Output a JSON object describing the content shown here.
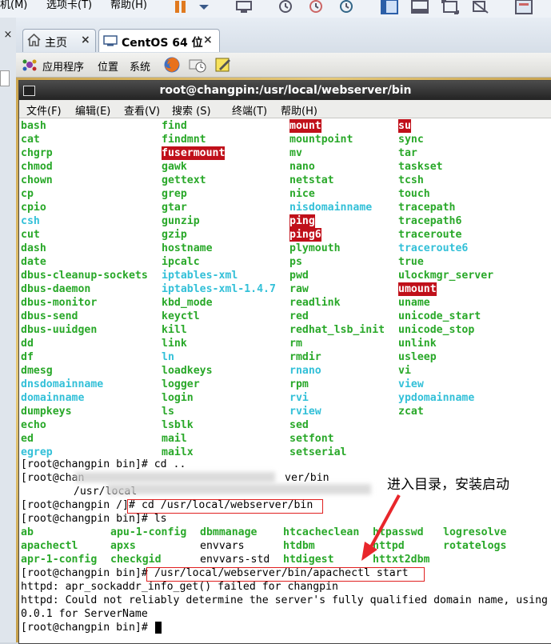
{
  "host": {
    "menu": [
      "机(M)",
      "选项卡(T)",
      "帮助(H)"
    ],
    "tabs": [
      {
        "label": "主页",
        "icon": "home-icon"
      },
      {
        "label": "CentOS 64 位",
        "icon": "vm-icon"
      }
    ],
    "close_glyph": "×"
  },
  "guest_panel": {
    "items": [
      "应用程序",
      "位置",
      "系统"
    ]
  },
  "terminal": {
    "title": "root@changpin:/usr/local/webserver/bin",
    "menu": [
      "文件(F)",
      "编辑(E)",
      "查看(V)",
      "搜索 (S)",
      "终端(T)",
      "帮助(H)"
    ],
    "bin_listing": [
      [
        [
          "bash",
          "g"
        ],
        [
          "find",
          "g"
        ],
        [
          "mount",
          "r"
        ],
        [
          "su",
          "r"
        ]
      ],
      [
        [
          "cat",
          "g"
        ],
        [
          "findmnt",
          "g"
        ],
        [
          "mountpoint",
          "g"
        ],
        [
          "sync",
          "g"
        ]
      ],
      [
        [
          "chgrp",
          "g"
        ],
        [
          "fusermount",
          "r"
        ],
        [
          "mv",
          "g"
        ],
        [
          "tar",
          "g"
        ]
      ],
      [
        [
          "chmod",
          "g"
        ],
        [
          "gawk",
          "g"
        ],
        [
          "nano",
          "g"
        ],
        [
          "taskset",
          "g"
        ]
      ],
      [
        [
          "chown",
          "g"
        ],
        [
          "gettext",
          "g"
        ],
        [
          "netstat",
          "g"
        ],
        [
          "tcsh",
          "g"
        ]
      ],
      [
        [
          "cp",
          "g"
        ],
        [
          "grep",
          "g"
        ],
        [
          "nice",
          "g"
        ],
        [
          "touch",
          "g"
        ]
      ],
      [
        [
          "cpio",
          "g"
        ],
        [
          "gtar",
          "g"
        ],
        [
          "nisdomainname",
          "b"
        ],
        [
          "tracepath",
          "g"
        ]
      ],
      [
        [
          "csh",
          "b"
        ],
        [
          "gunzip",
          "g"
        ],
        [
          "ping",
          "r"
        ],
        [
          "tracepath6",
          "g"
        ]
      ],
      [
        [
          "cut",
          "g"
        ],
        [
          "gzip",
          "g"
        ],
        [
          "ping6",
          "r"
        ],
        [
          "traceroute",
          "g"
        ]
      ],
      [
        [
          "dash",
          "g"
        ],
        [
          "hostname",
          "g"
        ],
        [
          "plymouth",
          "g"
        ],
        [
          "traceroute6",
          "b"
        ]
      ],
      [
        [
          "date",
          "g"
        ],
        [
          "ipcalc",
          "g"
        ],
        [
          "ps",
          "g"
        ],
        [
          "true",
          "g"
        ]
      ],
      [
        [
          "dbus-cleanup-sockets",
          "g"
        ],
        [
          "iptables-xml",
          "b"
        ],
        [
          "pwd",
          "g"
        ],
        [
          "ulockmgr_server",
          "g"
        ]
      ],
      [
        [
          "dbus-daemon",
          "g"
        ],
        [
          "iptables-xml-1.4.7",
          "b"
        ],
        [
          "raw",
          "g"
        ],
        [
          "umount",
          "r"
        ]
      ],
      [
        [
          "dbus-monitor",
          "g"
        ],
        [
          "kbd_mode",
          "g"
        ],
        [
          "readlink",
          "g"
        ],
        [
          "uname",
          "g"
        ]
      ],
      [
        [
          "dbus-send",
          "g"
        ],
        [
          "keyctl",
          "g"
        ],
        [
          "red",
          "g"
        ],
        [
          "unicode_start",
          "g"
        ]
      ],
      [
        [
          "dbus-uuidgen",
          "g"
        ],
        [
          "kill",
          "g"
        ],
        [
          "redhat_lsb_init",
          "g"
        ],
        [
          "unicode_stop",
          "g"
        ]
      ],
      [
        [
          "dd",
          "g"
        ],
        [
          "link",
          "g"
        ],
        [
          "rm",
          "g"
        ],
        [
          "unlink",
          "g"
        ]
      ],
      [
        [
          "df",
          "g"
        ],
        [
          "ln",
          "b"
        ],
        [
          "rmdir",
          "g"
        ],
        [
          "usleep",
          "g"
        ]
      ],
      [
        [
          "dmesg",
          "g"
        ],
        [
          "loadkeys",
          "g"
        ],
        [
          "rnano",
          "b"
        ],
        [
          "vi",
          "g"
        ]
      ],
      [
        [
          "dnsdomainname",
          "b"
        ],
        [
          "logger",
          "g"
        ],
        [
          "rpm",
          "g"
        ],
        [
          "view",
          "b"
        ]
      ],
      [
        [
          "domainname",
          "b"
        ],
        [
          "login",
          "g"
        ],
        [
          "rvi",
          "b"
        ],
        [
          "ypdomainname",
          "b"
        ]
      ],
      [
        [
          "dumpkeys",
          "g"
        ],
        [
          "ls",
          "g"
        ],
        [
          "rview",
          "b"
        ],
        [
          "zcat",
          "g"
        ]
      ],
      [
        [
          "echo",
          "g"
        ],
        [
          "lsblk",
          "g"
        ],
        [
          "sed",
          "g"
        ],
        [
          "",
          ""
        ]
      ],
      [
        [
          "ed",
          "g"
        ],
        [
          "mail",
          "g"
        ],
        [
          "setfont",
          "g"
        ],
        [
          "",
          ""
        ]
      ],
      [
        [
          "egrep",
          "b"
        ],
        [
          "mailx",
          "g"
        ],
        [
          "setserial",
          "g"
        ],
        [
          "",
          ""
        ]
      ]
    ],
    "line_cd_parent": "[root@changpin bin]# cd ..",
    "line_obscured_1": "[root@chan",
    "line_obscured_1_tail": "ver/bin",
    "line_obscured_2": "  /usr/local",
    "line_cd_prompt": "[root@changpin /]#",
    "line_cd_cmd": " cd /usr/local/webserver/bin",
    "line_ls": "[root@changpin bin]# ls",
    "dir_listing": [
      [
        [
          "ab",
          "g"
        ],
        [
          "apu-1-config",
          "g"
        ],
        [
          "dbmmanage",
          "g"
        ],
        [
          "htcacheclean",
          "g"
        ],
        [
          "htpasswd",
          "g"
        ],
        [
          "logresolve",
          "g"
        ]
      ],
      [
        [
          "apachectl",
          "g"
        ],
        [
          "apxs",
          "g"
        ],
        [
          "envvars",
          "plain"
        ],
        [
          "htdbm",
          "g"
        ],
        [
          "httpd",
          "g"
        ],
        [
          "rotatelogs",
          "g"
        ]
      ],
      [
        [
          "apr-1-config",
          "g"
        ],
        [
          "checkgid",
          "g"
        ],
        [
          "envvars-std",
          "plain"
        ],
        [
          "htdigest",
          "g"
        ],
        [
          "httxt2dbm",
          "g"
        ],
        [
          "",
          ""
        ]
      ]
    ],
    "line_start_prompt": "[root@changpin bin]#",
    "line_start_cmd": " /usr/local/webserver/bin/apachectl start",
    "out_1": "httpd: apr_sockaddr_info_get() failed for changpin",
    "out_2": "httpd: Could not reliably determine the server's fully qualified domain name, using 127.",
    "out_3": "0.0.1 for ServerName",
    "line_final": "[root@changpin bin]# "
  },
  "annotation": {
    "text": "进入目录，安装启动",
    "color": "#e8262b"
  },
  "colors": {
    "exec_green": "#29a829",
    "link_cyan": "#33c0d8",
    "setuid_red": "#c0101a"
  }
}
